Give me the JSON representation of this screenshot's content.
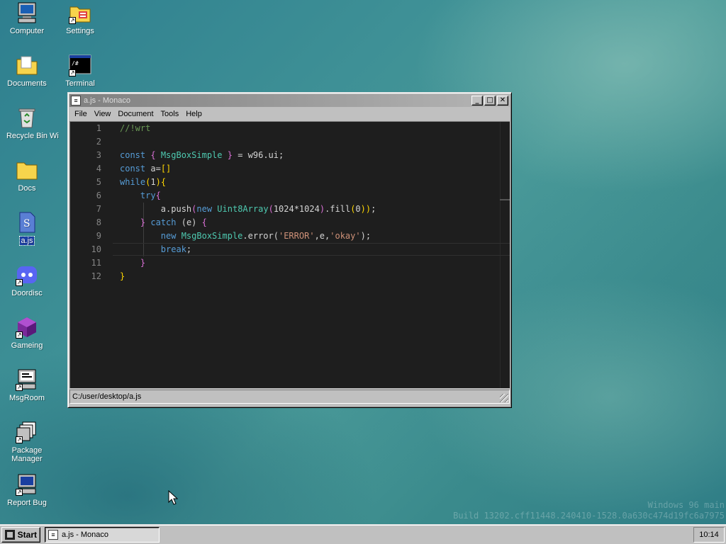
{
  "desktop": {
    "icons": [
      {
        "label": "Computer",
        "icon": "computer-icon"
      },
      {
        "label": "Settings",
        "icon": "settings-icon"
      },
      {
        "label": "Documents",
        "icon": "documents-folder-icon"
      },
      {
        "label": "Terminal",
        "icon": "terminal-icon"
      },
      {
        "label": "Recycle Bin",
        "icon": "recycle-bin-icon"
      },
      {
        "label": "Wi",
        "icon": "partially-hidden-icon"
      },
      {
        "label": "Docs",
        "icon": "docs-folder-icon"
      },
      {
        "label": "a.js",
        "icon": "js-file-icon"
      },
      {
        "label": "Doordisc",
        "icon": "doordisc-icon"
      },
      {
        "label": "Gameing",
        "icon": "gameing-icon"
      },
      {
        "label": "MsgRoom",
        "icon": "msgroom-icon"
      },
      {
        "label": "Package Manager",
        "icon": "package-manager-icon"
      },
      {
        "label": "Report Bug",
        "icon": "report-bug-icon"
      }
    ],
    "watermark": {
      "line1": "Windows 96 main",
      "line2": "Build 13202.cff11448.240410-1528.0a630c474d19fc6a7975"
    }
  },
  "window": {
    "title": "a.js - Monaco",
    "controls": {
      "minimize": "_",
      "maximize": "□",
      "close": "✕"
    },
    "menu": [
      "File",
      "View",
      "Document",
      "Tools",
      "Help"
    ],
    "editor": {
      "active_line": 10,
      "lines": [
        {
          "n": "1",
          "tokens": [
            {
              "t": "//!wrt",
              "c": "comment"
            }
          ]
        },
        {
          "n": "2",
          "tokens": []
        },
        {
          "n": "3",
          "tokens": [
            {
              "t": "const",
              "c": "kw"
            },
            {
              "t": " { ",
              "c": "punc"
            },
            {
              "t": "MsgBoxSimple",
              "c": "type"
            },
            {
              "t": " } ",
              "c": "punc"
            },
            {
              "t": "= w96.ui;",
              "c": "plain"
            }
          ]
        },
        {
          "n": "4",
          "tokens": [
            {
              "t": "const",
              "c": "kw"
            },
            {
              "t": " a=",
              "c": "plain"
            },
            {
              "t": "[]",
              "c": "bracket"
            }
          ]
        },
        {
          "n": "5",
          "tokens": [
            {
              "t": "while",
              "c": "kw"
            },
            {
              "t": "(",
              "c": "bracket"
            },
            {
              "t": "1",
              "c": "plain"
            },
            {
              "t": "){",
              "c": "bracket"
            }
          ]
        },
        {
          "n": "6",
          "tokens": [
            {
              "t": "    ",
              "c": "plain"
            },
            {
              "t": "try",
              "c": "kw"
            },
            {
              "t": "{",
              "c": "punc"
            }
          ]
        },
        {
          "n": "7",
          "tokens": [
            {
              "t": "        a.push",
              "c": "plain"
            },
            {
              "t": "(",
              "c": "punc"
            },
            {
              "t": "new",
              "c": "kw"
            },
            {
              "t": " Uint8Array",
              "c": "type"
            },
            {
              "t": "(",
              "c": "punc"
            },
            {
              "t": "1024*1024",
              "c": "plain"
            },
            {
              "t": ")",
              "c": "punc"
            },
            {
              "t": ".fill",
              "c": "plain"
            },
            {
              "t": "(",
              "c": "bracket"
            },
            {
              "t": "0",
              "c": "plain"
            },
            {
              "t": "))",
              "c": "bracket"
            },
            {
              "t": ";",
              "c": "plain"
            }
          ]
        },
        {
          "n": "8",
          "tokens": [
            {
              "t": "    ",
              "c": "plain"
            },
            {
              "t": "}",
              "c": "punc"
            },
            {
              "t": " catch",
              "c": "kw"
            },
            {
              "t": " (e) ",
              "c": "plain"
            },
            {
              "t": "{",
              "c": "punc"
            }
          ]
        },
        {
          "n": "9",
          "tokens": [
            {
              "t": "        ",
              "c": "plain"
            },
            {
              "t": "new",
              "c": "kw"
            },
            {
              "t": " MsgBoxSimple",
              "c": "type"
            },
            {
              "t": ".error(",
              "c": "plain"
            },
            {
              "t": "'ERROR'",
              "c": "str"
            },
            {
              "t": ",e,",
              "c": "plain"
            },
            {
              "t": "'okay'",
              "c": "str"
            },
            {
              "t": ");",
              "c": "plain"
            }
          ]
        },
        {
          "n": "10",
          "tokens": [
            {
              "t": "        ",
              "c": "plain"
            },
            {
              "t": "break",
              "c": "kw"
            },
            {
              "t": ";",
              "c": "plain"
            }
          ]
        },
        {
          "n": "11",
          "tokens": [
            {
              "t": "    ",
              "c": "plain"
            },
            {
              "t": "}",
              "c": "punc"
            }
          ]
        },
        {
          "n": "12",
          "tokens": [
            {
              "t": "}",
              "c": "bracket"
            }
          ]
        }
      ]
    },
    "status_path": "C:/user/desktop/a.js"
  },
  "taskbar": {
    "start_label": "Start",
    "task_label": "a.js - Monaco",
    "clock": "10:14"
  },
  "colors": {
    "kw": "#569cd6",
    "type": "#4ec9b0",
    "punc": "#da70d6",
    "bracket": "#ffd700",
    "str": "#ce9178",
    "comment": "#6a9955",
    "plain": "#d4d4d4"
  }
}
